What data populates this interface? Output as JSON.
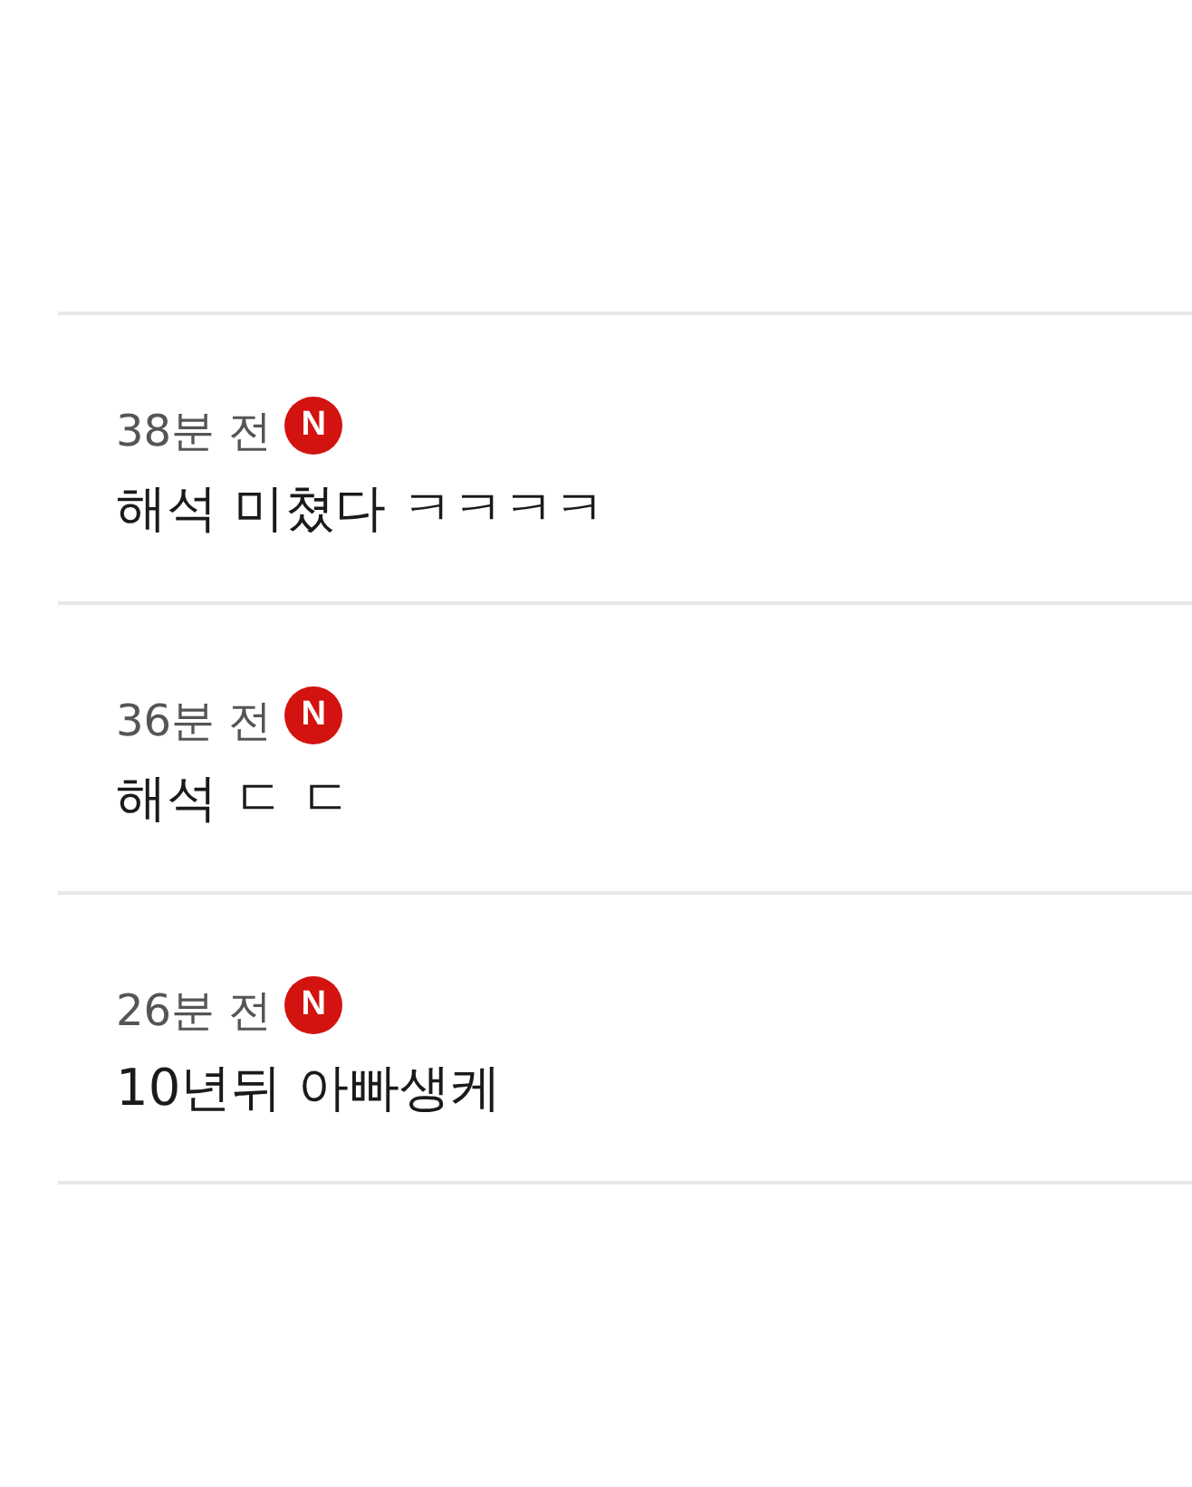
{
  "comments": [
    {
      "time": "38분 전",
      "badge": "N",
      "text": "해석 미쳤다 ㅋㅋㅋㅋ"
    },
    {
      "time": "36분 전",
      "badge": "N",
      "text": "해석 ㄷ ㄷ"
    },
    {
      "time": "26분 전",
      "badge": "N",
      "text": "10년뒤 아빠생케"
    }
  ]
}
